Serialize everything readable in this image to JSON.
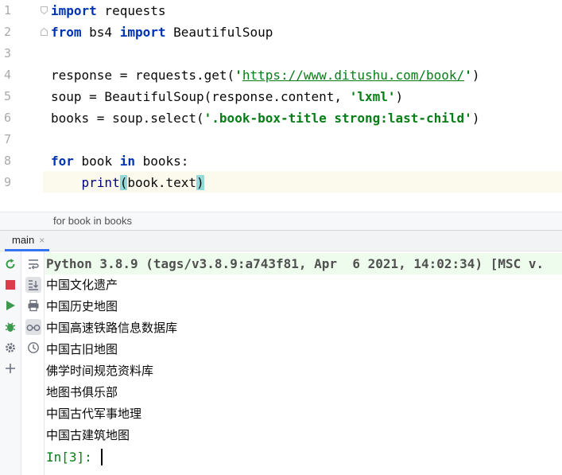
{
  "editor": {
    "line_numbers": [
      "1",
      "2",
      "3",
      "4",
      "5",
      "6",
      "7",
      "8",
      "9"
    ],
    "lines": [
      {
        "tokens": [
          {
            "t": "import",
            "c": "kw"
          },
          {
            "t": " requests",
            "c": ""
          }
        ]
      },
      {
        "tokens": [
          {
            "t": "from",
            "c": "kw"
          },
          {
            "t": " bs4 ",
            "c": ""
          },
          {
            "t": "import",
            "c": "kw"
          },
          {
            "t": " BeautifulSoup",
            "c": ""
          }
        ]
      },
      {
        "tokens": []
      },
      {
        "tokens": [
          {
            "t": "response = requests.get(",
            "c": ""
          },
          {
            "t": "'",
            "c": "str"
          },
          {
            "t": "https://www.ditushu.com/book/",
            "c": "url"
          },
          {
            "t": "'",
            "c": "str"
          },
          {
            "t": ")",
            "c": ""
          }
        ]
      },
      {
        "tokens": [
          {
            "t": "soup = BeautifulSoup(response.content, ",
            "c": ""
          },
          {
            "t": "'lxml'",
            "c": "str"
          },
          {
            "t": ")",
            "c": ""
          }
        ]
      },
      {
        "tokens": [
          {
            "t": "books = soup.select(",
            "c": ""
          },
          {
            "t": "'.book-box-title strong:last-child'",
            "c": "str"
          },
          {
            "t": ")",
            "c": ""
          }
        ]
      },
      {
        "tokens": []
      },
      {
        "tokens": [
          {
            "t": "for",
            "c": "kw"
          },
          {
            "t": " book ",
            "c": ""
          },
          {
            "t": "in",
            "c": "kw"
          },
          {
            "t": " books:",
            "c": ""
          }
        ]
      },
      {
        "tokens": [
          {
            "t": "    ",
            "c": ""
          },
          {
            "t": "print",
            "c": "bi"
          },
          {
            "t": "(",
            "c": "paren-hl"
          },
          {
            "t": "book.text",
            "c": ""
          },
          {
            "t": ")",
            "c": "paren-hl"
          }
        ]
      }
    ]
  },
  "breadcrumb": {
    "text": "for book in books"
  },
  "tool_window": {
    "tab_label": "main",
    "tab_close": "×"
  },
  "console": {
    "banner": "Python 3.8.9 (tags/v3.8.9:a743f81, Apr  6 2021, 14:02:34) [MSC v.",
    "output": [
      "中国文化遗产",
      "中国历史地图",
      "中国高速铁路信息数据库",
      "中国古旧地图",
      "佛学时间规范资料库",
      "地图书俱乐部",
      "中国古代军事地理",
      "中国古建筑地图"
    ],
    "prompt": "In[3]: "
  },
  "icons": {
    "left_toolbar": [
      "rerun-icon",
      "stop-icon",
      "run-icon",
      "debug-icon",
      "settings-icon",
      "add-icon"
    ],
    "second_toolbar": [
      "soft-wrap-icon",
      "scroll-to-end-icon",
      "print-icon",
      "show-variables-icon",
      "history-icon"
    ]
  },
  "colors": {
    "keyword": "#0033b3",
    "string": "#067d17",
    "caret_row": "#fcfaed",
    "banner_bg": "#edfcec",
    "tab_underline": "#3574f0"
  }
}
